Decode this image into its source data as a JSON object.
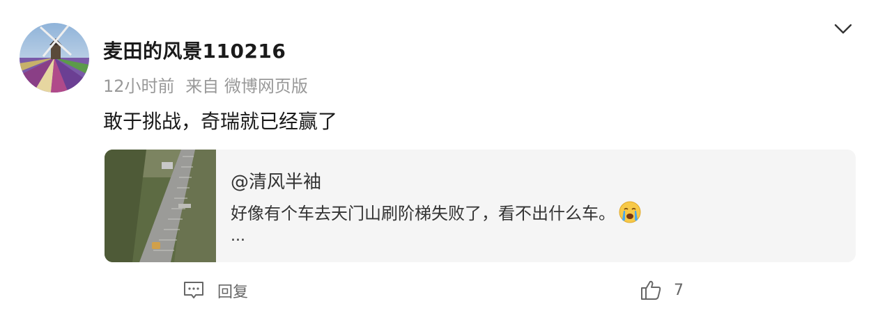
{
  "post": {
    "username": "麦田的风景110216",
    "time": "12小时前",
    "source": "来自 微博网页版",
    "text": "敢于挑战，奇瑞就已经赢了"
  },
  "quote": {
    "author": "@清风半袖",
    "text": "好像有个车去天门山刷阶梯失败了，看不出什么车。",
    "emoji": "😭",
    "more": "..."
  },
  "actions": {
    "reply_label": "回复",
    "like_count": "7"
  },
  "icons": {
    "menu": "chevron-down-icon",
    "reply": "comment-icon",
    "like": "thumbs-up-icon"
  },
  "colors": {
    "username": "#1a1a1a",
    "meta": "#999999",
    "card_background": "#f5f5f5",
    "action": "#666666"
  }
}
